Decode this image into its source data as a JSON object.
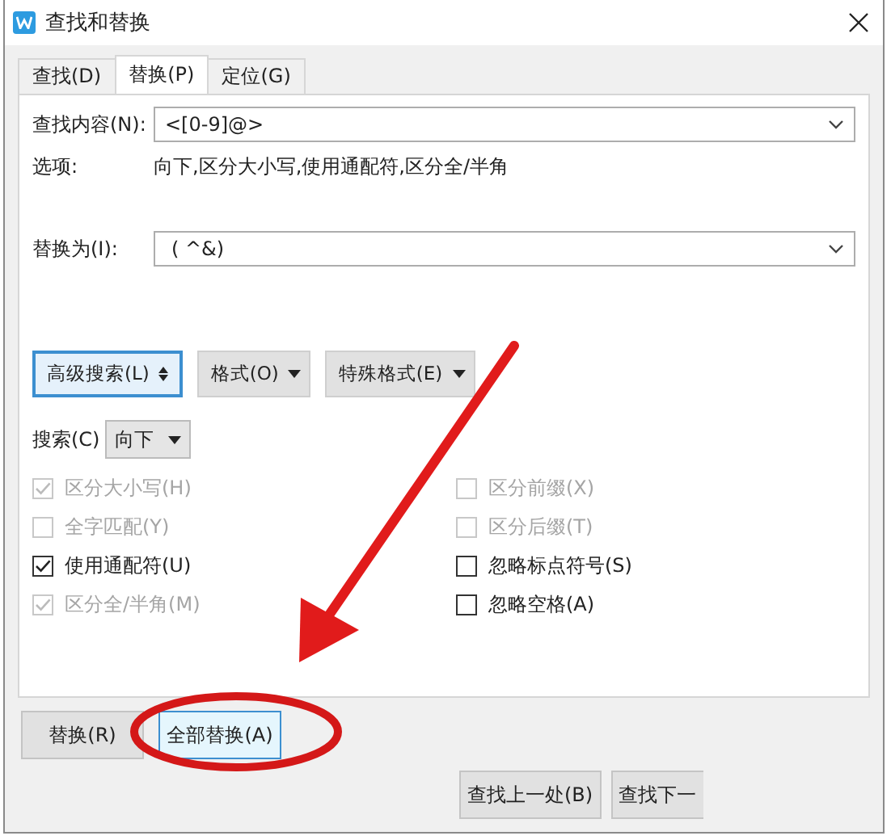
{
  "window": {
    "title": "查找和替换"
  },
  "tabs": [
    {
      "label": "查找(D)",
      "selected": false
    },
    {
      "label": "替换(P)",
      "selected": true
    },
    {
      "label": "定位(G)",
      "selected": false
    }
  ],
  "find": {
    "label": "查找内容(N):",
    "value": "<[0-9]@>"
  },
  "options": {
    "label": "选项:",
    "value": "向下,区分大小写,使用通配符,区分全/半角"
  },
  "replace": {
    "label": "替换为(I):",
    "value": "( ^&)"
  },
  "tool_buttons": [
    {
      "label": "高级搜索(L)",
      "kind": "expand",
      "focused": true
    },
    {
      "label": "格式(O)",
      "kind": "menu",
      "focused": false
    },
    {
      "label": "特殊格式(E)",
      "kind": "menu",
      "focused": false
    }
  ],
  "search_direction": {
    "label": "搜索(C)",
    "value": "向下"
  },
  "checkboxes": {
    "left": [
      {
        "label": "区分大小写(H)",
        "checked": true,
        "disabled": true
      },
      {
        "label": "全字匹配(Y)",
        "checked": false,
        "disabled": true
      },
      {
        "label": "使用通配符(U)",
        "checked": true,
        "disabled": false
      },
      {
        "label": "区分全/半角(M)",
        "checked": true,
        "disabled": true
      }
    ],
    "right": [
      {
        "label": "区分前缀(X)",
        "checked": false,
        "disabled": true
      },
      {
        "label": "区分后缀(T)",
        "checked": false,
        "disabled": true
      },
      {
        "label": "忽略标点符号(S)",
        "checked": false,
        "disabled": false
      },
      {
        "label": "忽略空格(A)",
        "checked": false,
        "disabled": false
      }
    ]
  },
  "action_buttons": [
    {
      "label": "替换(R)",
      "focused": false
    },
    {
      "label": "全部替换(A)",
      "focused": true
    }
  ],
  "nav_buttons": [
    {
      "label": "查找上一处(B)"
    },
    {
      "label": "查找下一"
    }
  ]
}
